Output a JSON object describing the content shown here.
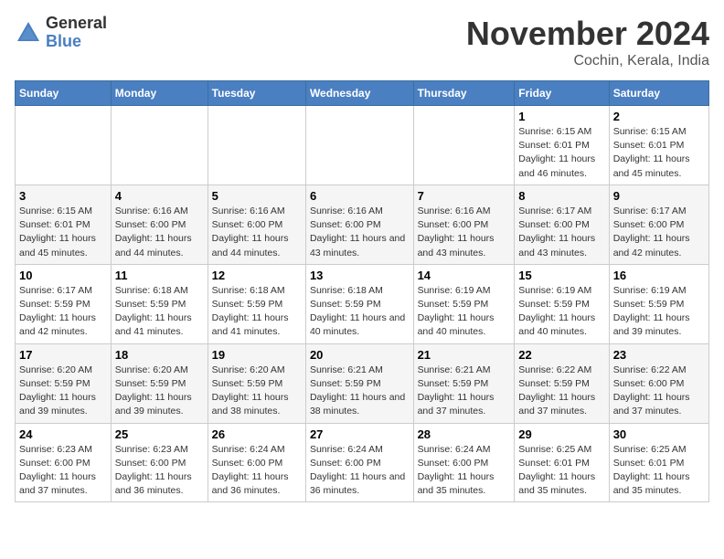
{
  "logo": {
    "general": "General",
    "blue": "Blue"
  },
  "title": "November 2024",
  "subtitle": "Cochin, Kerala, India",
  "days_header": [
    "Sunday",
    "Monday",
    "Tuesday",
    "Wednesday",
    "Thursday",
    "Friday",
    "Saturday"
  ],
  "weeks": [
    [
      {
        "num": "",
        "sunrise": "",
        "sunset": "",
        "daylight": ""
      },
      {
        "num": "",
        "sunrise": "",
        "sunset": "",
        "daylight": ""
      },
      {
        "num": "",
        "sunrise": "",
        "sunset": "",
        "daylight": ""
      },
      {
        "num": "",
        "sunrise": "",
        "sunset": "",
        "daylight": ""
      },
      {
        "num": "",
        "sunrise": "",
        "sunset": "",
        "daylight": ""
      },
      {
        "num": "1",
        "sunrise": "Sunrise: 6:15 AM",
        "sunset": "Sunset: 6:01 PM",
        "daylight": "Daylight: 11 hours and 46 minutes."
      },
      {
        "num": "2",
        "sunrise": "Sunrise: 6:15 AM",
        "sunset": "Sunset: 6:01 PM",
        "daylight": "Daylight: 11 hours and 45 minutes."
      }
    ],
    [
      {
        "num": "3",
        "sunrise": "Sunrise: 6:15 AM",
        "sunset": "Sunset: 6:01 PM",
        "daylight": "Daylight: 11 hours and 45 minutes."
      },
      {
        "num": "4",
        "sunrise": "Sunrise: 6:16 AM",
        "sunset": "Sunset: 6:00 PM",
        "daylight": "Daylight: 11 hours and 44 minutes."
      },
      {
        "num": "5",
        "sunrise": "Sunrise: 6:16 AM",
        "sunset": "Sunset: 6:00 PM",
        "daylight": "Daylight: 11 hours and 44 minutes."
      },
      {
        "num": "6",
        "sunrise": "Sunrise: 6:16 AM",
        "sunset": "Sunset: 6:00 PM",
        "daylight": "Daylight: 11 hours and 43 minutes."
      },
      {
        "num": "7",
        "sunrise": "Sunrise: 6:16 AM",
        "sunset": "Sunset: 6:00 PM",
        "daylight": "Daylight: 11 hours and 43 minutes."
      },
      {
        "num": "8",
        "sunrise": "Sunrise: 6:17 AM",
        "sunset": "Sunset: 6:00 PM",
        "daylight": "Daylight: 11 hours and 43 minutes."
      },
      {
        "num": "9",
        "sunrise": "Sunrise: 6:17 AM",
        "sunset": "Sunset: 6:00 PM",
        "daylight": "Daylight: 11 hours and 42 minutes."
      }
    ],
    [
      {
        "num": "10",
        "sunrise": "Sunrise: 6:17 AM",
        "sunset": "Sunset: 5:59 PM",
        "daylight": "Daylight: 11 hours and 42 minutes."
      },
      {
        "num": "11",
        "sunrise": "Sunrise: 6:18 AM",
        "sunset": "Sunset: 5:59 PM",
        "daylight": "Daylight: 11 hours and 41 minutes."
      },
      {
        "num": "12",
        "sunrise": "Sunrise: 6:18 AM",
        "sunset": "Sunset: 5:59 PM",
        "daylight": "Daylight: 11 hours and 41 minutes."
      },
      {
        "num": "13",
        "sunrise": "Sunrise: 6:18 AM",
        "sunset": "Sunset: 5:59 PM",
        "daylight": "Daylight: 11 hours and 40 minutes."
      },
      {
        "num": "14",
        "sunrise": "Sunrise: 6:19 AM",
        "sunset": "Sunset: 5:59 PM",
        "daylight": "Daylight: 11 hours and 40 minutes."
      },
      {
        "num": "15",
        "sunrise": "Sunrise: 6:19 AM",
        "sunset": "Sunset: 5:59 PM",
        "daylight": "Daylight: 11 hours and 40 minutes."
      },
      {
        "num": "16",
        "sunrise": "Sunrise: 6:19 AM",
        "sunset": "Sunset: 5:59 PM",
        "daylight": "Daylight: 11 hours and 39 minutes."
      }
    ],
    [
      {
        "num": "17",
        "sunrise": "Sunrise: 6:20 AM",
        "sunset": "Sunset: 5:59 PM",
        "daylight": "Daylight: 11 hours and 39 minutes."
      },
      {
        "num": "18",
        "sunrise": "Sunrise: 6:20 AM",
        "sunset": "Sunset: 5:59 PM",
        "daylight": "Daylight: 11 hours and 39 minutes."
      },
      {
        "num": "19",
        "sunrise": "Sunrise: 6:20 AM",
        "sunset": "Sunset: 5:59 PM",
        "daylight": "Daylight: 11 hours and 38 minutes."
      },
      {
        "num": "20",
        "sunrise": "Sunrise: 6:21 AM",
        "sunset": "Sunset: 5:59 PM",
        "daylight": "Daylight: 11 hours and 38 minutes."
      },
      {
        "num": "21",
        "sunrise": "Sunrise: 6:21 AM",
        "sunset": "Sunset: 5:59 PM",
        "daylight": "Daylight: 11 hours and 37 minutes."
      },
      {
        "num": "22",
        "sunrise": "Sunrise: 6:22 AM",
        "sunset": "Sunset: 5:59 PM",
        "daylight": "Daylight: 11 hours and 37 minutes."
      },
      {
        "num": "23",
        "sunrise": "Sunrise: 6:22 AM",
        "sunset": "Sunset: 6:00 PM",
        "daylight": "Daylight: 11 hours and 37 minutes."
      }
    ],
    [
      {
        "num": "24",
        "sunrise": "Sunrise: 6:23 AM",
        "sunset": "Sunset: 6:00 PM",
        "daylight": "Daylight: 11 hours and 37 minutes."
      },
      {
        "num": "25",
        "sunrise": "Sunrise: 6:23 AM",
        "sunset": "Sunset: 6:00 PM",
        "daylight": "Daylight: 11 hours and 36 minutes."
      },
      {
        "num": "26",
        "sunrise": "Sunrise: 6:24 AM",
        "sunset": "Sunset: 6:00 PM",
        "daylight": "Daylight: 11 hours and 36 minutes."
      },
      {
        "num": "27",
        "sunrise": "Sunrise: 6:24 AM",
        "sunset": "Sunset: 6:00 PM",
        "daylight": "Daylight: 11 hours and 36 minutes."
      },
      {
        "num": "28",
        "sunrise": "Sunrise: 6:24 AM",
        "sunset": "Sunset: 6:00 PM",
        "daylight": "Daylight: 11 hours and 35 minutes."
      },
      {
        "num": "29",
        "sunrise": "Sunrise: 6:25 AM",
        "sunset": "Sunset: 6:01 PM",
        "daylight": "Daylight: 11 hours and 35 minutes."
      },
      {
        "num": "30",
        "sunrise": "Sunrise: 6:25 AM",
        "sunset": "Sunset: 6:01 PM",
        "daylight": "Daylight: 11 hours and 35 minutes."
      }
    ]
  ]
}
